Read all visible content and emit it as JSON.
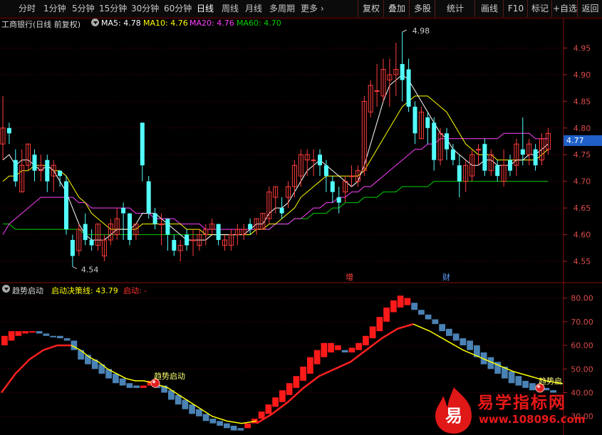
{
  "toolbar": {
    "left_items": [
      "分时",
      "1分钟",
      "5分钟",
      "15分钟",
      "30分钟",
      "60分钟",
      "日线",
      "周线",
      "月线",
      "多周期",
      "更多"
    ],
    "active": "日线",
    "right_items": [
      "复权",
      "叠加",
      "多股",
      "统计",
      "画线",
      "F10",
      "标记",
      "+自选",
      "返回"
    ]
  },
  "legend": {
    "stock": "工商银行(日线 前复权)",
    "ma5": "MA5: 4.78",
    "ma10": "MA10: 4.76",
    "ma20": "MA20: 4.76",
    "ma60": "MA60: 4.70"
  },
  "price_axis": [
    "4.95",
    "4.90",
    "4.85",
    "4.80",
    "4.75",
    "4.70",
    "4.65",
    "4.60",
    "4.55"
  ],
  "current_price": "4.77",
  "annotations": {
    "high": "4.98",
    "low": "4.54",
    "mark1": "增",
    "mark2": "财"
  },
  "indicator": {
    "name": "趋势启动",
    "decision": "启动决策线: 43.79",
    "start": "启动: -",
    "signal_label": "趋势启动",
    "signal_label2": "趋势启",
    "axis": [
      "80.00",
      "70.00",
      "60.00",
      "50.00",
      "40.00",
      "30.00"
    ]
  },
  "logo": {
    "title": "易学指标网",
    "url": "www.108096.com",
    "glyph": "易"
  },
  "colors": {
    "up": "#ff3c3c",
    "down": "#54ffff",
    "ma5": "#ffffff",
    "ma10": "#ffff00",
    "ma20": "#ff40ff",
    "ma60": "#00d200",
    "ind_up": "#ff1a1a",
    "ind_down": "#4a82b4"
  },
  "chart_data": {
    "type": "candlestick",
    "candles": [
      [
        4.77,
        4.8,
        4.74,
        4.86
      ],
      [
        4.8,
        4.79,
        4.77,
        4.81
      ],
      [
        4.74,
        4.7,
        4.69,
        4.76
      ],
      [
        4.68,
        4.73,
        4.68,
        4.76
      ],
      [
        4.73,
        4.77,
        4.72,
        4.77
      ],
      [
        4.75,
        4.72,
        4.7,
        4.76
      ],
      [
        4.72,
        4.73,
        4.7,
        4.75
      ],
      [
        4.74,
        4.7,
        4.68,
        4.75
      ],
      [
        4.71,
        4.73,
        4.68,
        4.74
      ],
      [
        4.72,
        4.71,
        4.69,
        4.72
      ],
      [
        4.7,
        4.61,
        4.6,
        4.71
      ],
      [
        4.59,
        4.56,
        4.54,
        4.6
      ],
      [
        4.57,
        4.61,
        4.56,
        4.62
      ],
      [
        4.62,
        4.59,
        4.58,
        4.64
      ],
      [
        4.59,
        4.58,
        4.57,
        4.61
      ],
      [
        4.58,
        4.62,
        4.57,
        4.62
      ],
      [
        4.56,
        4.59,
        4.55,
        4.6
      ],
      [
        4.59,
        4.62,
        4.58,
        4.63
      ],
      [
        4.6,
        4.63,
        4.59,
        4.65
      ],
      [
        4.65,
        4.64,
        4.59,
        4.66
      ],
      [
        4.64,
        4.59,
        4.58,
        4.64
      ],
      [
        4.6,
        4.62,
        4.59,
        4.62
      ],
      [
        4.81,
        4.73,
        4.7,
        4.81
      ],
      [
        4.7,
        4.64,
        4.63,
        4.71
      ],
      [
        4.64,
        4.62,
        4.61,
        4.65
      ],
      [
        4.62,
        4.62,
        4.58,
        4.64
      ],
      [
        4.63,
        4.6,
        4.57,
        4.63
      ],
      [
        4.59,
        4.57,
        4.56,
        4.6
      ],
      [
        4.57,
        4.58,
        4.55,
        4.59
      ],
      [
        4.6,
        4.58,
        4.57,
        4.61
      ],
      [
        4.59,
        4.59,
        4.56,
        4.61
      ],
      [
        4.58,
        4.6,
        4.57,
        4.61
      ],
      [
        4.6,
        4.61,
        4.58,
        4.62
      ],
      [
        4.61,
        4.62,
        4.6,
        4.63
      ],
      [
        4.62,
        4.59,
        4.58,
        4.62
      ],
      [
        4.58,
        4.59,
        4.57,
        4.6
      ],
      [
        4.58,
        4.6,
        4.57,
        4.61
      ],
      [
        4.6,
        4.61,
        4.58,
        4.62
      ],
      [
        4.6,
        4.61,
        4.59,
        4.62
      ],
      [
        4.62,
        4.61,
        4.6,
        4.63
      ],
      [
        4.61,
        4.63,
        4.6,
        4.63
      ],
      [
        4.61,
        4.64,
        4.61,
        4.64
      ],
      [
        4.63,
        4.68,
        4.62,
        4.69
      ],
      [
        4.67,
        4.69,
        4.64,
        4.69
      ],
      [
        4.65,
        4.64,
        4.63,
        4.67
      ],
      [
        4.67,
        4.69,
        4.65,
        4.7
      ],
      [
        4.69,
        4.73,
        4.67,
        4.74
      ],
      [
        4.71,
        4.75,
        4.69,
        4.76
      ],
      [
        4.74,
        4.75,
        4.71,
        4.76
      ],
      [
        4.74,
        4.74,
        4.71,
        4.76
      ],
      [
        4.75,
        4.73,
        4.71,
        4.76
      ],
      [
        4.73,
        4.71,
        4.68,
        4.74
      ],
      [
        4.7,
        4.68,
        4.66,
        4.71
      ],
      [
        4.67,
        4.66,
        4.64,
        4.69
      ],
      [
        4.68,
        4.7,
        4.66,
        4.71
      ],
      [
        4.71,
        4.71,
        4.69,
        4.73
      ],
      [
        4.7,
        4.72,
        4.69,
        4.73
      ],
      [
        4.72,
        4.85,
        4.71,
        4.86
      ],
      [
        4.83,
        4.88,
        4.82,
        4.89
      ],
      [
        4.87,
        4.87,
        4.84,
        4.92
      ],
      [
        4.86,
        4.91,
        4.85,
        4.93
      ],
      [
        4.89,
        4.9,
        4.84,
        4.93
      ],
      [
        4.9,
        4.91,
        4.86,
        4.96
      ],
      [
        4.92,
        4.89,
        4.85,
        4.98
      ],
      [
        4.91,
        4.84,
        4.83,
        4.93
      ],
      [
        4.84,
        4.79,
        4.77,
        4.85
      ],
      [
        4.78,
        4.83,
        4.78,
        4.84
      ],
      [
        4.82,
        4.8,
        4.77,
        4.83
      ],
      [
        4.81,
        4.74,
        4.72,
        4.82
      ],
      [
        4.74,
        4.79,
        4.73,
        4.8
      ],
      [
        4.79,
        4.76,
        4.74,
        4.8
      ],
      [
        4.76,
        4.74,
        4.73,
        4.77
      ],
      [
        4.73,
        4.7,
        4.67,
        4.75
      ],
      [
        4.7,
        4.73,
        4.68,
        4.74
      ],
      [
        4.71,
        4.75,
        4.7,
        4.76
      ],
      [
        4.76,
        4.76,
        4.73,
        4.77
      ],
      [
        4.77,
        4.72,
        4.71,
        4.78
      ],
      [
        4.72,
        4.75,
        4.71,
        4.76
      ],
      [
        4.73,
        4.71,
        4.7,
        4.74
      ],
      [
        4.7,
        4.73,
        4.69,
        4.76
      ],
      [
        4.74,
        4.72,
        4.71,
        4.75
      ],
      [
        4.73,
        4.77,
        4.71,
        4.78
      ],
      [
        4.76,
        4.75,
        4.73,
        4.82
      ],
      [
        4.75,
        4.77,
        4.73,
        4.78
      ],
      [
        4.76,
        4.73,
        4.72,
        4.77
      ],
      [
        4.74,
        4.78,
        4.73,
        4.79
      ],
      [
        4.76,
        4.79,
        4.75,
        4.8
      ]
    ],
    "ma5": [
      4.74,
      4.75,
      4.73,
      4.74,
      4.74,
      4.73,
      4.72,
      4.73,
      4.72,
      4.7,
      4.68,
      4.65,
      4.62,
      4.6,
      4.59,
      4.59,
      4.59,
      4.6,
      4.61,
      4.61,
      4.61,
      4.62,
      4.64,
      4.64,
      4.64,
      4.63,
      4.62,
      4.61,
      4.6,
      4.59,
      4.59,
      4.59,
      4.59,
      4.6,
      4.6,
      4.6,
      4.6,
      4.6,
      4.6,
      4.61,
      4.62,
      4.62,
      4.64,
      4.65,
      4.65,
      4.66,
      4.68,
      4.7,
      4.72,
      4.73,
      4.74,
      4.73,
      4.72,
      4.71,
      4.7,
      4.69,
      4.7,
      4.73,
      4.77,
      4.81,
      4.85,
      4.88,
      4.89,
      4.9,
      4.89,
      4.87,
      4.85,
      4.83,
      4.81,
      4.79,
      4.78,
      4.76,
      4.75,
      4.74,
      4.73,
      4.73,
      4.74,
      4.74,
      4.73,
      4.73,
      4.73,
      4.74,
      4.74,
      4.75,
      4.75,
      4.76,
      4.77
    ],
    "ma10": [
      4.7,
      4.71,
      4.71,
      4.72,
      4.72,
      4.73,
      4.73,
      4.73,
      4.72,
      4.72,
      4.71,
      4.69,
      4.67,
      4.66,
      4.64,
      4.63,
      4.62,
      4.61,
      4.61,
      4.61,
      4.61,
      4.61,
      4.62,
      4.62,
      4.62,
      4.62,
      4.62,
      4.62,
      4.62,
      4.61,
      4.61,
      4.61,
      4.6,
      4.6,
      4.6,
      4.6,
      4.6,
      4.6,
      4.6,
      4.6,
      4.61,
      4.61,
      4.62,
      4.62,
      4.63,
      4.64,
      4.65,
      4.67,
      4.68,
      4.69,
      4.7,
      4.71,
      4.71,
      4.71,
      4.71,
      4.71,
      4.71,
      4.72,
      4.74,
      4.76,
      4.78,
      4.8,
      4.82,
      4.84,
      4.85,
      4.86,
      4.86,
      4.86,
      4.85,
      4.84,
      4.83,
      4.81,
      4.79,
      4.77,
      4.76,
      4.75,
      4.75,
      4.75,
      4.74,
      4.74,
      4.74,
      4.74,
      4.74,
      4.74,
      4.74,
      4.75,
      4.76
    ],
    "ma20": [
      4.6,
      4.62,
      4.63,
      4.64,
      4.65,
      4.66,
      4.67,
      4.67,
      4.67,
      4.67,
      4.67,
      4.67,
      4.66,
      4.66,
      4.65,
      4.65,
      4.65,
      4.65,
      4.65,
      4.65,
      4.65,
      4.64,
      4.64,
      4.64,
      4.63,
      4.63,
      4.63,
      4.63,
      4.62,
      4.62,
      4.62,
      4.62,
      4.61,
      4.61,
      4.61,
      4.61,
      4.61,
      4.61,
      4.61,
      4.61,
      4.61,
      4.61,
      4.61,
      4.62,
      4.62,
      4.62,
      4.63,
      4.63,
      4.64,
      4.65,
      4.65,
      4.66,
      4.66,
      4.67,
      4.67,
      4.68,
      4.68,
      4.69,
      4.69,
      4.7,
      4.71,
      4.72,
      4.73,
      4.74,
      4.75,
      4.76,
      4.76,
      4.77,
      4.77,
      4.78,
      4.78,
      4.78,
      4.78,
      4.78,
      4.78,
      4.78,
      4.78,
      4.78,
      4.78,
      4.79,
      4.79,
      4.79,
      4.79,
      4.79,
      4.78,
      4.78,
      4.78
    ],
    "ma60": [
      4.62,
      4.62,
      4.61,
      4.61,
      4.61,
      4.61,
      4.61,
      4.61,
      4.61,
      4.61,
      4.61,
      4.61,
      4.61,
      4.6,
      4.6,
      4.6,
      4.6,
      4.6,
      4.6,
      4.6,
      4.6,
      4.6,
      4.6,
      4.6,
      4.6,
      4.6,
      4.6,
      4.6,
      4.6,
      4.6,
      4.6,
      4.6,
      4.6,
      4.6,
      4.6,
      4.6,
      4.6,
      4.6,
      4.6,
      4.6,
      4.61,
      4.61,
      4.61,
      4.62,
      4.62,
      4.62,
      4.63,
      4.63,
      4.63,
      4.64,
      4.64,
      4.64,
      4.65,
      4.65,
      4.66,
      4.66,
      4.66,
      4.67,
      4.67,
      4.67,
      4.68,
      4.68,
      4.68,
      4.69,
      4.69,
      4.69,
      4.69,
      4.69,
      4.7,
      4.7,
      4.7,
      4.7,
      4.7,
      4.7,
      4.7,
      4.7,
      4.7,
      4.7,
      4.7,
      4.7,
      4.7,
      4.7,
      4.7,
      4.7,
      4.7,
      4.7,
      4.7
    ],
    "ind_bars": [
      [
        60,
        64
      ],
      [
        62,
        66
      ],
      [
        64,
        66
      ],
      [
        65,
        66
      ],
      [
        66,
        66
      ],
      [
        65,
        66
      ],
      [
        64,
        65
      ],
      [
        64,
        64
      ],
      [
        63,
        64
      ],
      [
        62,
        63
      ],
      [
        58,
        62
      ],
      [
        54,
        58
      ],
      [
        52,
        56
      ],
      [
        50,
        54
      ],
      [
        48,
        52
      ],
      [
        46,
        50
      ],
      [
        44,
        48
      ],
      [
        43,
        46
      ],
      [
        42,
        44
      ],
      [
        42,
        43
      ],
      [
        42,
        43
      ],
      [
        43,
        45
      ],
      [
        42,
        43
      ],
      [
        40,
        43
      ],
      [
        37,
        41
      ],
      [
        35,
        39
      ],
      [
        33,
        37
      ],
      [
        31,
        35
      ],
      [
        30,
        33
      ],
      [
        28,
        31
      ],
      [
        27,
        29
      ],
      [
        26,
        28
      ],
      [
        25,
        27
      ],
      [
        24,
        26
      ],
      [
        24,
        25
      ],
      [
        25,
        27
      ],
      [
        27,
        29
      ],
      [
        29,
        32
      ],
      [
        31,
        35
      ],
      [
        34,
        38
      ],
      [
        36,
        41
      ],
      [
        39,
        44
      ],
      [
        42,
        47
      ],
      [
        45,
        51
      ],
      [
        48,
        55
      ],
      [
        52,
        58
      ],
      [
        55,
        61
      ],
      [
        57,
        61
      ],
      [
        58,
        60
      ],
      [
        57,
        58
      ],
      [
        57,
        59
      ],
      [
        58,
        61
      ],
      [
        60,
        64
      ],
      [
        63,
        68
      ],
      [
        66,
        72
      ],
      [
        70,
        76
      ],
      [
        74,
        79
      ],
      [
        76,
        81
      ],
      [
        77,
        80
      ],
      [
        75,
        78
      ],
      [
        73,
        75
      ],
      [
        71,
        73
      ],
      [
        69,
        71
      ],
      [
        66,
        69
      ],
      [
        64,
        67
      ],
      [
        62,
        65
      ],
      [
        60,
        63
      ],
      [
        58,
        62
      ],
      [
        55,
        60
      ],
      [
        52,
        57
      ],
      [
        50,
        55
      ],
      [
        48,
        53
      ],
      [
        46,
        51
      ],
      [
        44,
        49
      ],
      [
        43,
        47
      ],
      [
        42,
        45
      ],
      [
        41,
        44
      ],
      [
        41,
        43
      ],
      [
        41,
        42
      ],
      [
        40,
        41
      ]
    ],
    "ind_red_line": [
      40,
      44,
      48,
      51,
      54,
      56,
      58,
      59,
      60,
      60,
      60
    ],
    "ind_yellow_line": [
      60,
      58,
      55,
      53,
      50,
      48,
      46,
      45,
      45,
      44
    ]
  }
}
